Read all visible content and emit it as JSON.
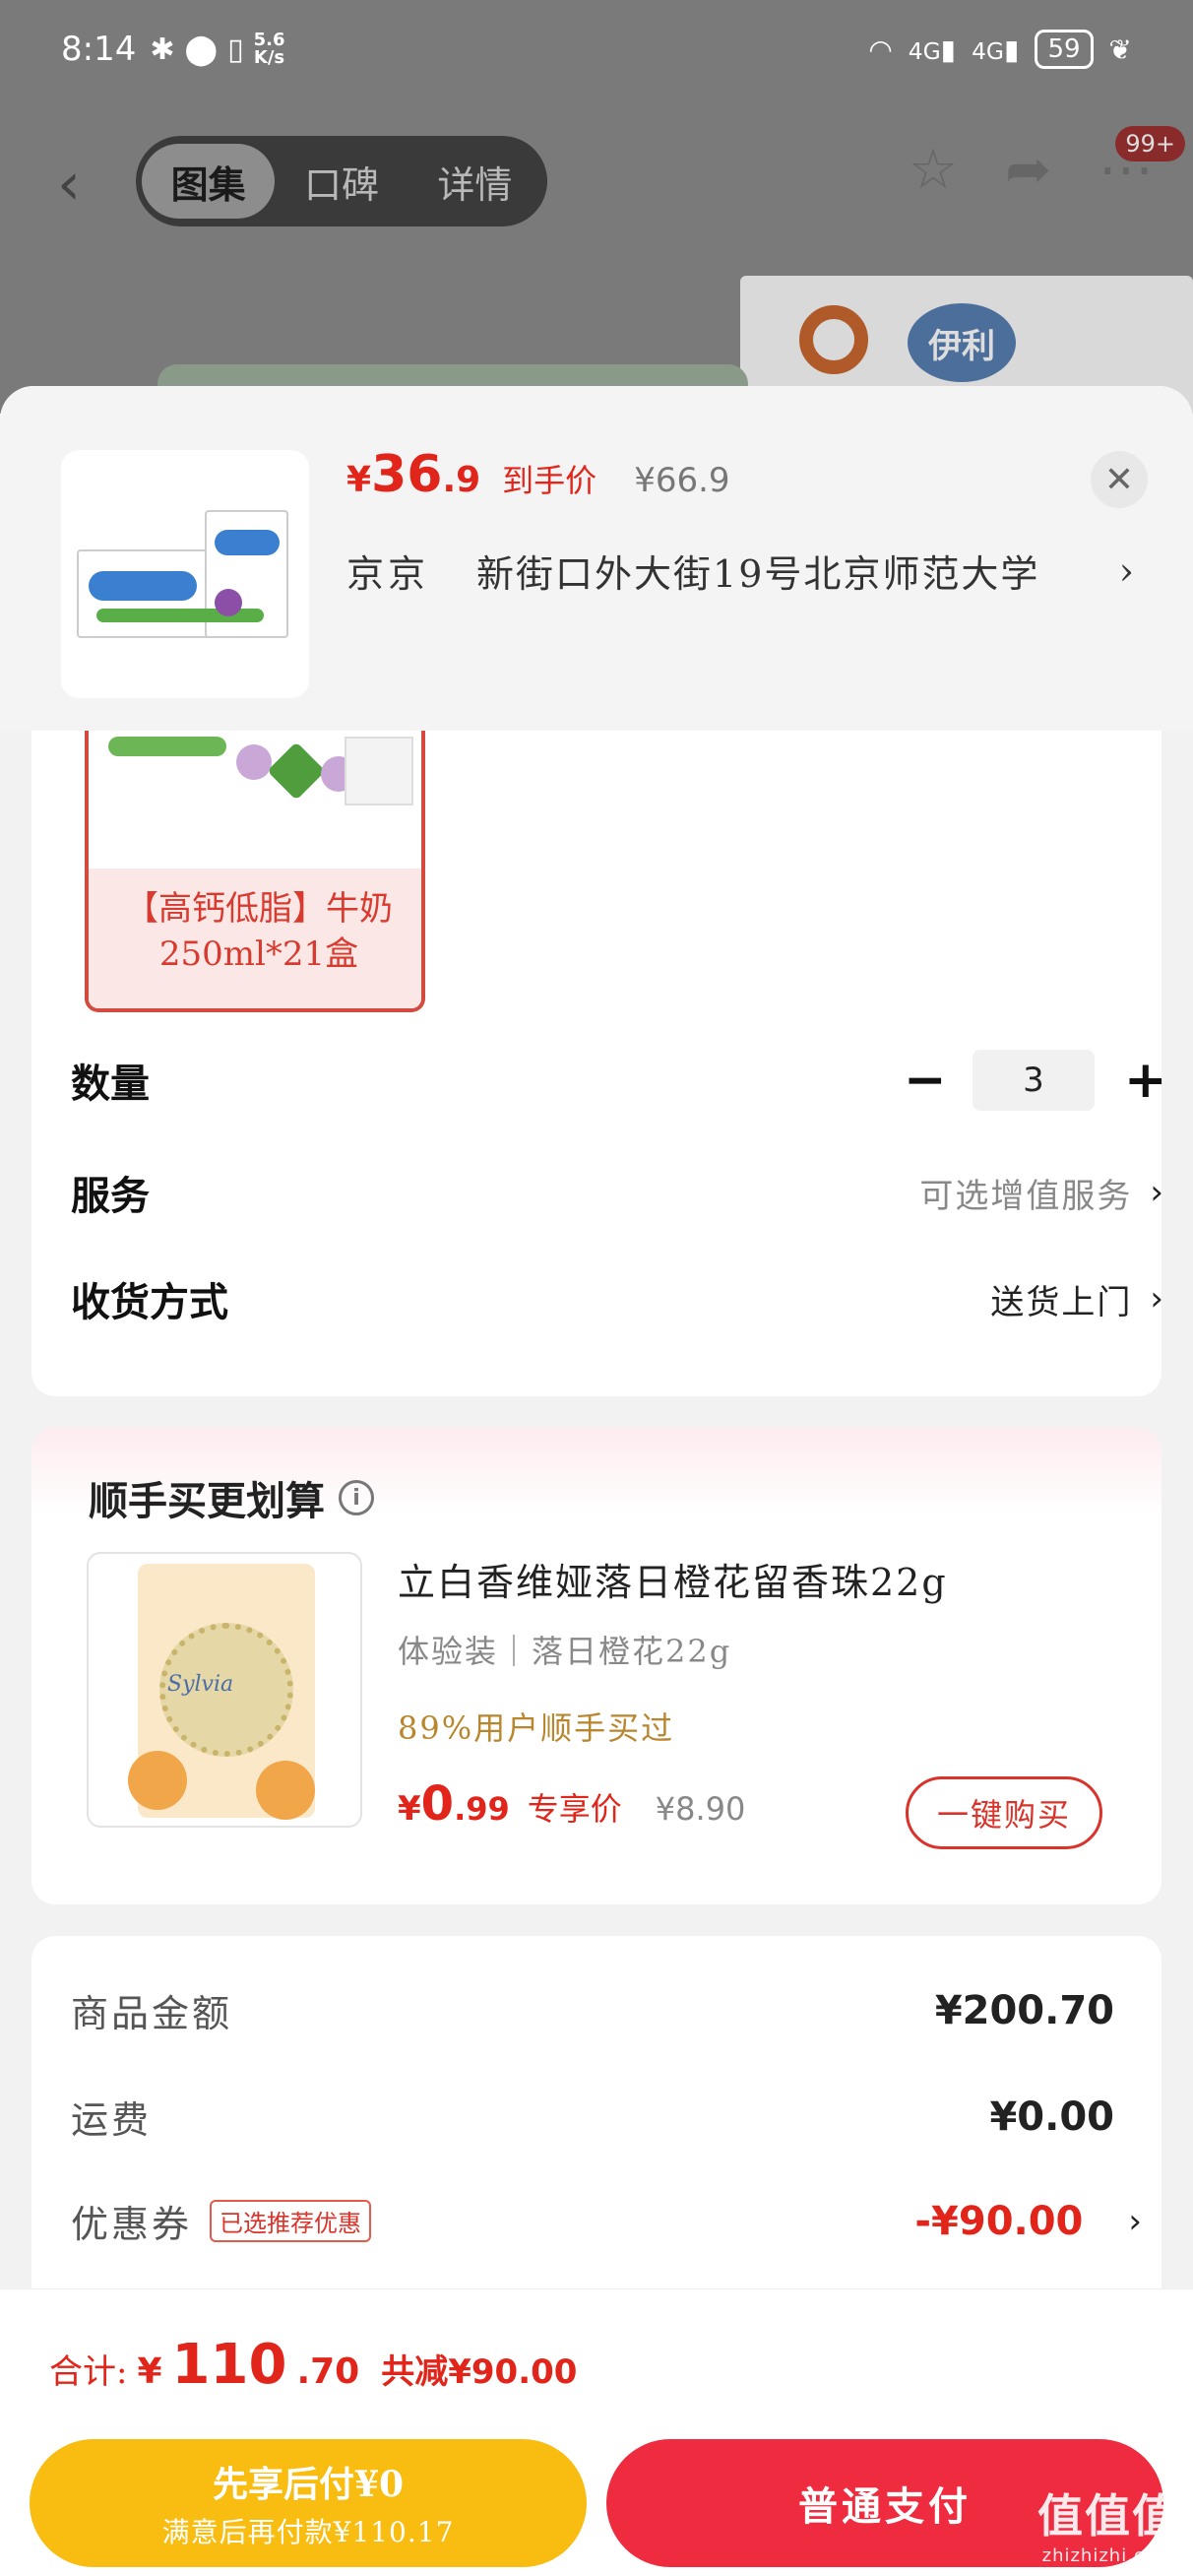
{
  "status_bar": {
    "time": "8:14",
    "net_speed_top": "5.6",
    "net_speed_bottom": "K/s",
    "signal_1": "4G",
    "signal_2": "4G",
    "battery": "59"
  },
  "nav": {
    "tabs": [
      {
        "label": "图集",
        "active": true
      },
      {
        "label": "口碑",
        "active": false
      },
      {
        "label": "详情",
        "active": false
      }
    ],
    "message_badge": "99+"
  },
  "background": {
    "brand_text": "伊利"
  },
  "product_header": {
    "price_symbol": "¥",
    "price_int": "36",
    "price_dec": ".9",
    "price_tag": "到手价",
    "original_price": "¥66.9",
    "address_city": "京京",
    "address_detail": "新街口外大街19号北京师范大学"
  },
  "spec": {
    "selected_caption": "【高钙低脂】牛奶250ml*21盒"
  },
  "quantity": {
    "label": "数量",
    "minus": "−",
    "value": "3",
    "plus": "+"
  },
  "service": {
    "label": "服务",
    "value": "可选增值服务"
  },
  "delivery": {
    "label": "收货方式",
    "value": "送货上门"
  },
  "bundle": {
    "title": "顺手买更划算",
    "product_name": "立白香维娅落日橙花留香珠22g",
    "spec": "体验装｜落日橙花22g",
    "social": "89%用户顺手买过",
    "price_symbol": "¥",
    "price_int": "0",
    "price_dec": ".99",
    "price_tag": "专享价",
    "original_price": "¥8.90",
    "buy_label": "一键购买",
    "pack_logo": "Sylvia"
  },
  "summary": {
    "goods_label": "商品金额",
    "goods_value": "¥200.70",
    "shipping_label": "运费",
    "shipping_value": "¥0.00",
    "coupon_label": "优惠券",
    "coupon_tag": "已选推荐优惠",
    "coupon_value": "-¥90.00"
  },
  "footer": {
    "total_label": "合计:",
    "total_symbol": "¥",
    "total_int": "110",
    "total_dec": ".70",
    "total_save": "共减¥90.00",
    "pay_later_title": "先享后付¥0",
    "pay_later_sub": "满意后再付款¥110.17",
    "pay_normal": "普通支付",
    "watermark_main": "值值值",
    "watermark_sub": "zhizhizhi.com"
  },
  "colors": {
    "accent_red": "#e1251b",
    "pay_later_yellow": "#f8bd10",
    "pay_normal_red": "#ef2c3f",
    "social_gold": "#b7862d"
  }
}
